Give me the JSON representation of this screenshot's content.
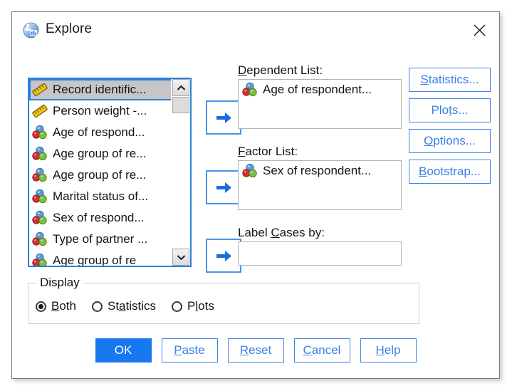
{
  "window": {
    "title": "Explore",
    "icon": "spss-explore-icon",
    "close_label": "×"
  },
  "source_list": {
    "name": "source-variable-list",
    "items": [
      {
        "label": "Record identific...",
        "icon": "scale-ruler-icon",
        "selected": true
      },
      {
        "label": "Person weight -...",
        "icon": "scale-ruler-icon",
        "selected": false
      },
      {
        "label": "Age of respond...",
        "icon": "nominal-circles-icon",
        "selected": false
      },
      {
        "label": "Age group of re...",
        "icon": "nominal-circles-icon",
        "selected": false
      },
      {
        "label": "Age group of re...",
        "icon": "nominal-circles-icon",
        "selected": false
      },
      {
        "label": "Marital status of...",
        "icon": "nominal-circles-icon",
        "selected": false
      },
      {
        "label": "Sex of respond...",
        "icon": "nominal-circles-icon",
        "selected": false
      },
      {
        "label": "Type of partner ...",
        "icon": "nominal-circles-icon",
        "selected": false
      },
      {
        "label": "Age group of re",
        "icon": "nominal-circles-icon",
        "selected": false
      }
    ]
  },
  "transfer_buttons": {
    "dependent": "➔",
    "factor": "➔",
    "label": "➔"
  },
  "fields": {
    "dependent": {
      "label_prefix": "",
      "label_accel": "D",
      "label_rest": "ependent List:",
      "items": [
        {
          "label": "Age of respondent...",
          "icon": "nominal-circles-icon"
        }
      ]
    },
    "factor": {
      "label_accel": "F",
      "label_rest": "actor List:",
      "items": [
        {
          "label": "Sex of respondent...",
          "icon": "nominal-circles-icon"
        }
      ]
    },
    "label_cases": {
      "label_pre": "Label ",
      "label_accel": "C",
      "label_rest": "ases by:",
      "value": "",
      "placeholder": ""
    }
  },
  "side_buttons": [
    {
      "name": "statistics-button",
      "accel": "S",
      "rest": "tatistics...",
      "full": "Statistics..."
    },
    {
      "name": "plots-button",
      "pre": "Plo",
      "accel": "t",
      "rest": "s...",
      "full": "Plots..."
    },
    {
      "name": "options-button",
      "accel": "O",
      "rest": "ptions...",
      "full": "Options..."
    },
    {
      "name": "bootstrap-button",
      "accel": "B",
      "rest": "ootstrap...",
      "full": "Bootstrap..."
    }
  ],
  "display_group": {
    "legend": "Display",
    "options": [
      {
        "name": "radio-both",
        "accel": "B",
        "rest": "oth",
        "full": "Both",
        "checked": true
      },
      {
        "name": "radio-statistics",
        "pre": "St",
        "accel": "a",
        "rest": "tistics",
        "full": "Statistics",
        "checked": false
      },
      {
        "name": "radio-plots",
        "pre": "P",
        "accel": "l",
        "rest": "ots",
        "full": "Plots",
        "checked": false
      }
    ]
  },
  "bottom_buttons": [
    {
      "name": "ok-button",
      "full": "OK",
      "primary": true
    },
    {
      "name": "paste-button",
      "accel": "P",
      "rest": "aste",
      "full": "Paste",
      "primary": false
    },
    {
      "name": "reset-button",
      "accel": "R",
      "rest": "eset",
      "full": "Reset",
      "primary": false
    },
    {
      "name": "cancel-button",
      "accel": "C",
      "rest": "ancel",
      "full": "Cancel",
      "primary": false
    },
    {
      "name": "help-button",
      "accel": "H",
      "rest": "elp",
      "full": "Help",
      "primary": false
    }
  ],
  "colors": {
    "accent_blue": "#3b7fe8",
    "primary_button": "#1878f0",
    "focus_border": "#2b7fe0",
    "selection_gray": "#c6c6c6"
  }
}
